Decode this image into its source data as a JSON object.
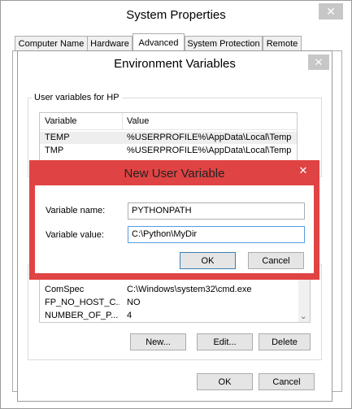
{
  "system_properties": {
    "title": "System Properties",
    "tabs": [
      {
        "label": "Computer Name"
      },
      {
        "label": "Hardware"
      },
      {
        "label": "Advanced"
      },
      {
        "label": "System Protection"
      },
      {
        "label": "Remote"
      }
    ],
    "active_tab": "Advanced"
  },
  "env_vars": {
    "title": "Environment Variables",
    "user_group_label": "User variables for HP",
    "user_columns": [
      "Variable",
      "Value"
    ],
    "user_rows": [
      {
        "variable": "TEMP",
        "value": "%USERPROFILE%\\AppData\\Local\\Temp"
      },
      {
        "variable": "TMP",
        "value": "%USERPROFILE%\\AppData\\Local\\Temp"
      }
    ],
    "system_rows": [
      {
        "variable": "ComSpec",
        "value": "C:\\Windows\\system32\\cmd.exe"
      },
      {
        "variable": "FP_NO_HOST_C...",
        "value": "NO"
      },
      {
        "variable": "NUMBER_OF_P...",
        "value": "4"
      }
    ],
    "buttons": {
      "new": "New...",
      "edit": "Edit...",
      "delete": "Delete"
    },
    "ok": "OK",
    "cancel": "Cancel"
  },
  "new_var": {
    "title": "New User Variable",
    "name_label": "Variable name:",
    "name_value": "PYTHONPATH",
    "value_label": "Variable value:",
    "value_value": "C:\\Python\\MyDir",
    "ok": "OK",
    "cancel": "Cancel",
    "accent": "#e04343"
  }
}
